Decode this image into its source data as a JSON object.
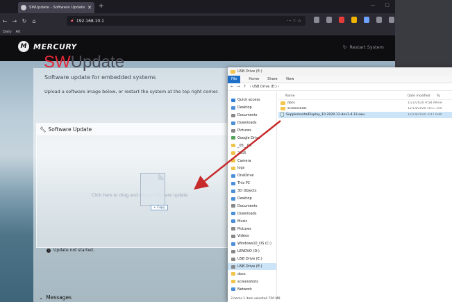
{
  "browser": {
    "tab_title": "SWUpdate - Software Update f",
    "tab_close": "✕",
    "new_tab": "+",
    "url": "192.168.10.1",
    "url_tail": "··· ♡ ☆",
    "bookmarks": [
      "Daily",
      "Alt"
    ]
  },
  "site": {
    "brand": "MERCURY",
    "logo_letter": "M",
    "restart": "Restart System"
  },
  "swupdate": {
    "title_sw": "SW",
    "title_update": "Update",
    "subtitle": "Software update for embedded systems",
    "instructions": "Upload a software image below, or restart the system at the top right corner.",
    "card_title": "Software Update",
    "drop_text": "Click here or drag and drop a software update",
    "copy_tag": "+ Copy",
    "status": "Update not started.",
    "messages_title": "Messages"
  },
  "explorer": {
    "window_title": "USB Drive (E:)",
    "ribbon": [
      "File",
      "Home",
      "Share",
      "View"
    ],
    "address": "› USB Drive (E:) ›",
    "col_name": "Name",
    "col_date": "Date modified",
    "col_type": "Ty",
    "files": [
      {
        "name": "docs",
        "date": "1/21/2020 9:58 AM",
        "type": "File"
      },
      {
        "name": "screenshots",
        "date": "12/14/2020 10:1...",
        "type": "File"
      },
      {
        "name": "SupplementalDisplay_10-2020-12-dev1-4.13.swu",
        "date": "12/14/2020 3:47 PM",
        "type": "SW"
      }
    ],
    "nav": [
      "Quick access",
      "Desktop",
      "Documents",
      "Downloads",
      "Pictures",
      "Google Drive",
      "_05__06",
      "2015",
      "Camera",
      "logs",
      "OneDrive",
      "This PC",
      "3D Objects",
      "Desktop",
      "Documents",
      "Downloads",
      "Music",
      "Pictures",
      "Videos",
      "Windows10_OS (C:)",
      "LENOVO (D:)",
      "USB Drive (E:)",
      "USB Drive (E:)",
      "docs",
      "screenshots",
      "Network"
    ],
    "status": "3 items    1 item selected  750 MB"
  },
  "colors": {
    "accent": "#e32636",
    "selected": "#cce4f7",
    "arrow": "#c62a2a"
  }
}
